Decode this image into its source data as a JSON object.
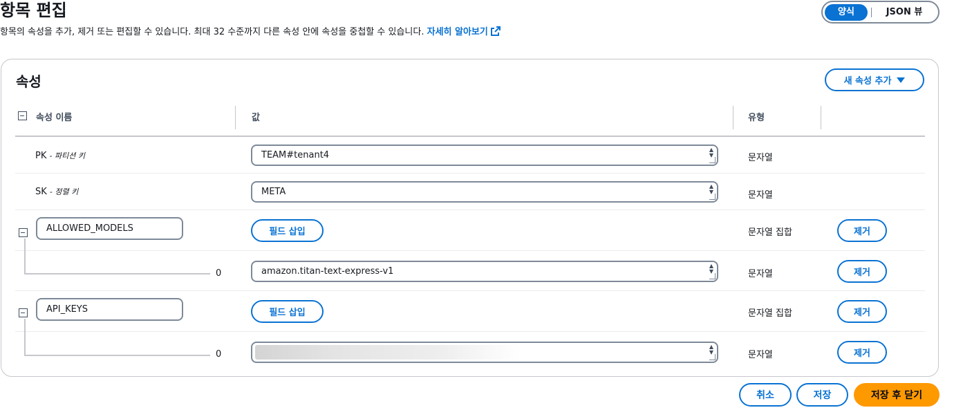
{
  "header": {
    "title": "항목 편집",
    "description": "항목의 속성을 추가, 제거 또는 편집할 수 있습니다. 최대 32 수준까지 다른 속성 안에 속성을 중첩할 수 있습니다.",
    "learn_more": "자세히 알아보기",
    "mode_form": "양식",
    "mode_json": "JSON 뷰"
  },
  "attributes": {
    "title": "속성",
    "add_button": "새 속성 추가",
    "columns": {
      "name": "속성 이름",
      "value": "값",
      "type": "유형"
    },
    "pk": {
      "name": "PK",
      "hint": "- 파티션 키",
      "value": "TEAM#tenant4",
      "type": "문자열"
    },
    "sk": {
      "name": "SK",
      "hint": "- 정렬 키",
      "value": "META",
      "type": "문자열"
    },
    "allowed_models": {
      "name": "ALLOWED_MODELS",
      "insert_button": "필드 삽입",
      "type": "문자열 집합",
      "remove_button": "제거",
      "item": {
        "index": "0",
        "value": "amazon.titan-text-express-v1",
        "type": "문자열",
        "remove_button": "제거"
      }
    },
    "api_keys": {
      "name": "API_KEYS",
      "insert_button": "필드 삽입",
      "type": "문자열 집합",
      "remove_button": "제거",
      "item": {
        "index": "0",
        "value": "",
        "type": "문자열",
        "remove_button": "제거"
      }
    }
  },
  "footer": {
    "cancel": "취소",
    "save": "저장",
    "save_close": "저장 후 닫기"
  },
  "colors": {
    "accent": "#0972d3",
    "primary": "#ff9900",
    "border": "#7d8998"
  }
}
